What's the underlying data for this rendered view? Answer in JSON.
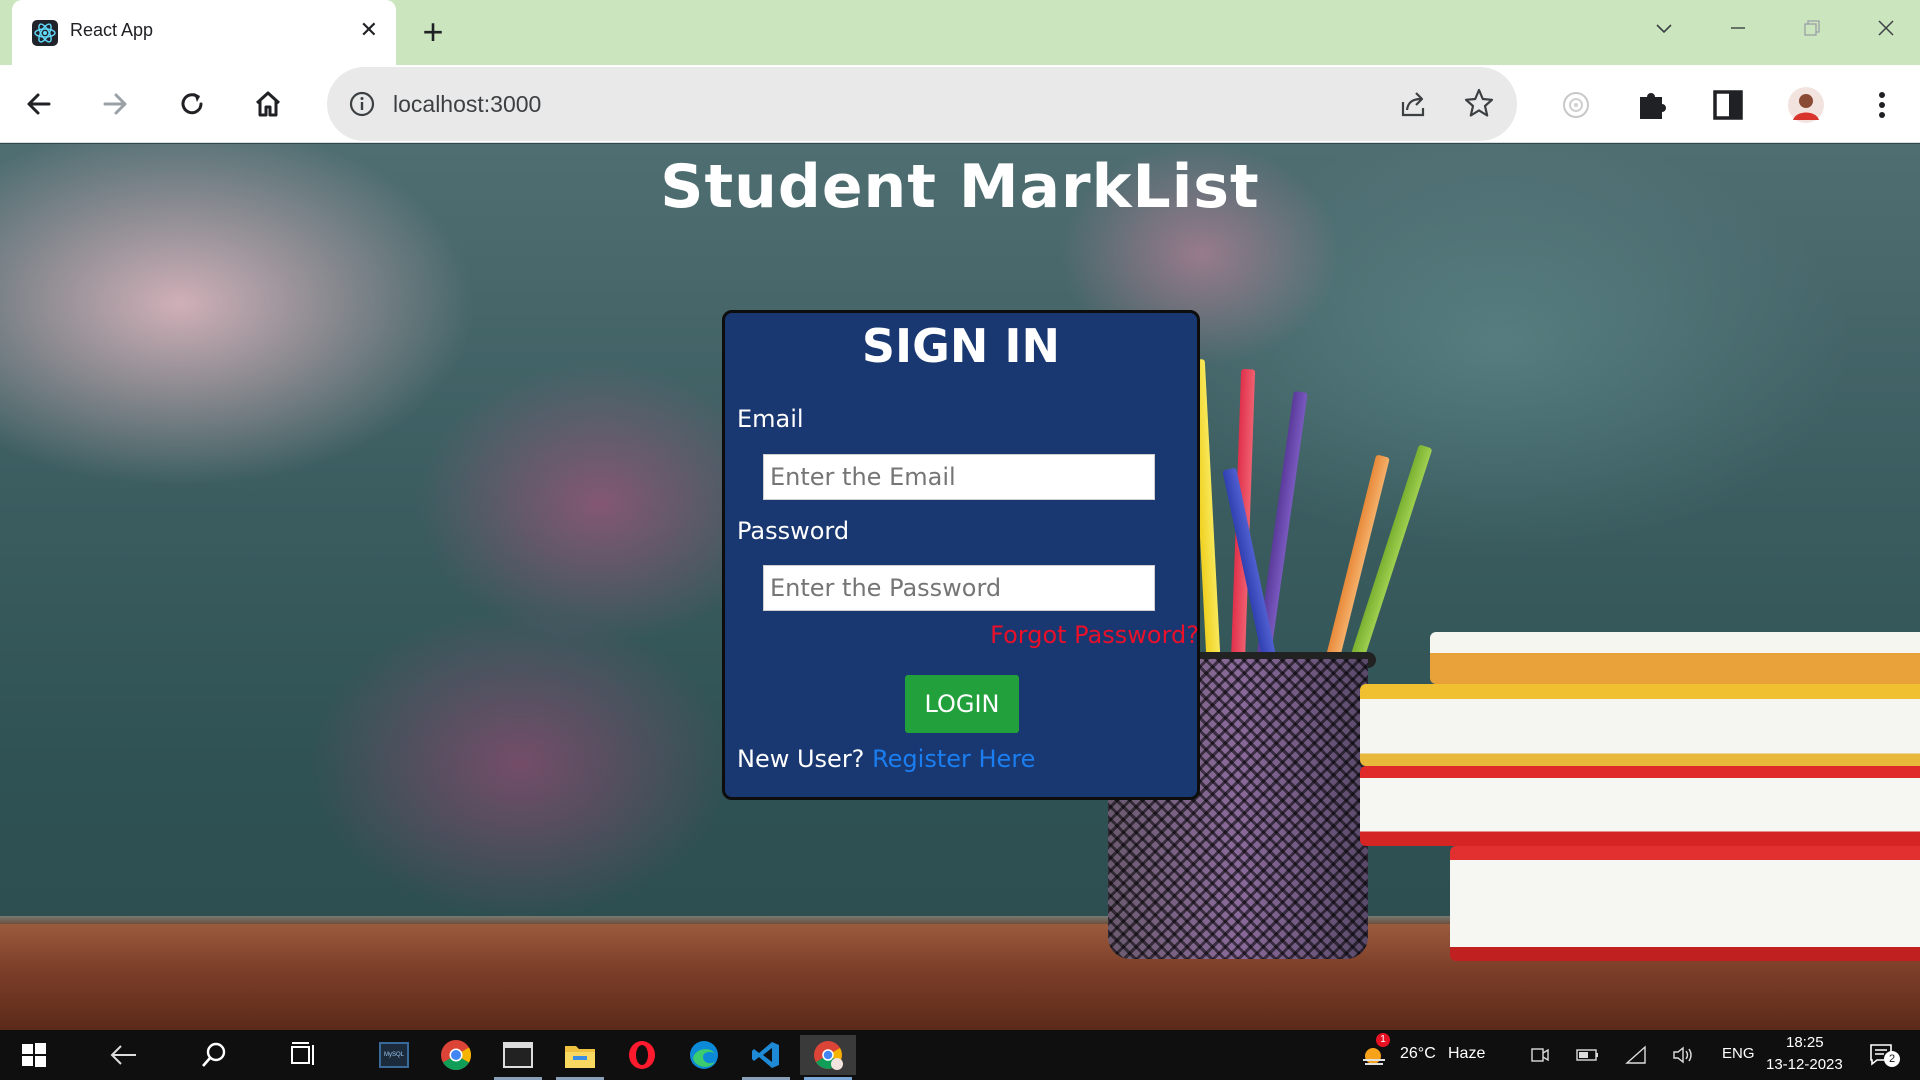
{
  "browser": {
    "tab_title": "React App",
    "url": "localhost:3000",
    "icons": [
      "react-icon",
      "close-icon",
      "plus-icon",
      "chevron-down-icon",
      "minimize-icon",
      "restore-icon",
      "window-close-icon",
      "back-icon",
      "forward-icon",
      "reload-icon",
      "home-icon",
      "info-icon",
      "share-icon",
      "star-icon",
      "extension-generic-icon",
      "puzzle-icon",
      "side-panel-icon",
      "profile-avatar",
      "kebab-menu-icon"
    ]
  },
  "page": {
    "title": "Student MarkList",
    "signin": {
      "heading": "SIGN IN",
      "email_label": "Email",
      "email_placeholder": "Enter the Email",
      "password_label": "Password",
      "password_placeholder": "Enter the Password",
      "forgot": "Forgot Password?",
      "login": "LOGIN",
      "new_user": "New User?",
      "register": "Register Here"
    },
    "colors": {
      "card": "#193770",
      "login": "#21a03c",
      "forgot": "#e8102a",
      "register": "#1a7ef0"
    }
  },
  "taskbar": {
    "weather_temp": "26°C",
    "weather_desc": "Haze",
    "language": "ENG",
    "time": "18:25",
    "date": "13-12-2023",
    "notification_count": "2",
    "weather_badge": "1",
    "mysql_label": "MySQL",
    "apps": [
      "windows-start-icon",
      "back-arrow-icon",
      "search-icon",
      "task-view-icon",
      "mysql-workbench-icon",
      "chrome-icon",
      "terminal-icon",
      "file-explorer-icon",
      "opera-icon",
      "edge-icon",
      "vscode-icon",
      "chrome-profile-icon"
    ]
  }
}
